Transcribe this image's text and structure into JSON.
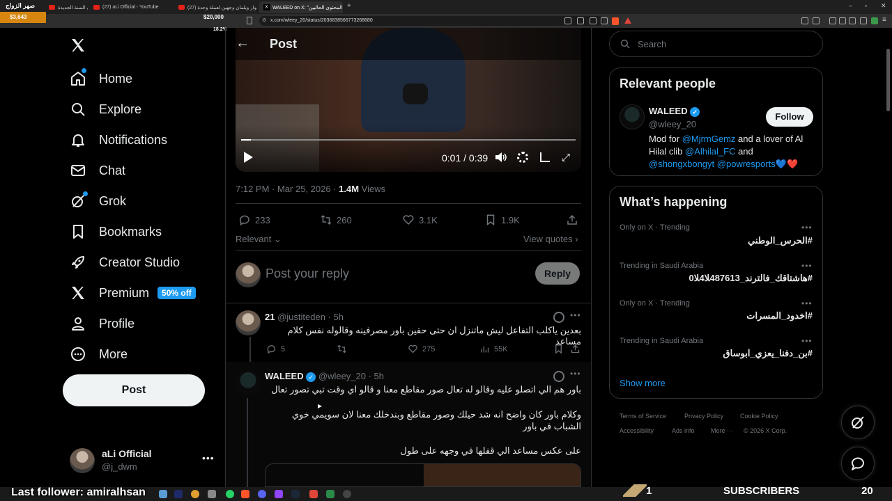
{
  "browser": {
    "tabs": [
      {
        "label": "اول بث في السنة الجديدة | aLi Official",
        "type": "youtube"
      },
      {
        "label": "(27) aLi Official - YouTube",
        "type": "youtube"
      },
      {
        "label": "(27) الحوار ويلمان وجهين لعملة وحدة",
        "type": "youtube"
      },
      {
        "label": "WALEED on X: \"المحتوى الحاليين",
        "type": "x"
      }
    ],
    "url": "x.com/wleey_20/status/2036838566773268680"
  },
  "overlay": {
    "channel_name": "صهر الزواج",
    "money_left": "$3,643",
    "money_right": "$20,000",
    "percent": "18.2%"
  },
  "nav": {
    "items": [
      {
        "label": "Home",
        "icon": "home-icon"
      },
      {
        "label": "Explore",
        "icon": "search-icon"
      },
      {
        "label": "Notifications",
        "icon": "bell-icon"
      },
      {
        "label": "Chat",
        "icon": "mail-icon"
      },
      {
        "label": "Grok",
        "icon": "grok-icon"
      },
      {
        "label": "Bookmarks",
        "icon": "bookmark-icon"
      },
      {
        "label": "Creator Studio",
        "icon": "rocket-icon"
      },
      {
        "label": "Premium",
        "icon": "x-logo-icon"
      },
      {
        "label": "Profile",
        "icon": "person-icon"
      },
      {
        "label": "More",
        "icon": "more-circle-icon"
      }
    ],
    "premium_badge": "50% off",
    "post_label": "Post"
  },
  "account": {
    "name": "aLi Official",
    "handle": "@j_dwm"
  },
  "header": {
    "title": "Post"
  },
  "video": {
    "time": "0:01 / 0:39"
  },
  "post": {
    "timestamp": "7:12 PM · Mar 25, 2026 · ",
    "views_count": "1.4M",
    "views_label": " Views",
    "replies": "233",
    "reposts": "260",
    "likes": "3.1K",
    "bookmarks": "1.9K",
    "sort_label": "Relevant",
    "view_quotes": "View quotes"
  },
  "composer": {
    "placeholder": "Post your reply",
    "reply_label": "Reply"
  },
  "replies": [
    {
      "name": "21",
      "handle": "@justiteden · 5h",
      "text": "بعدين ياكلب التفاعل ليش ماتنزل ان حتى حقين باور مصرفينه وقالوله نفس كلام مساعد",
      "replies": "5",
      "likes": "275",
      "views": "55K"
    },
    {
      "name": "WALEED",
      "handle": "@wleey_20 · 5h",
      "text1": "باور هم الي اتصلو عليه وقالو له تعال صور مقاطع معنا و قالو اي وقت تبي تصور تعال",
      "text2": "وكلام باور كان واضح انه شد حيلك وصور مقاطع وبندخلك معنا لان سويمي خوي الشباب في باور",
      "text3": "على عكس مساعد الي قفلها في وجهه على طول"
    }
  ],
  "search": {
    "placeholder": "Search"
  },
  "relevant": {
    "title": "Relevant people",
    "name": "WALEED",
    "handle": "@wleey_20",
    "follow": "Follow",
    "bio_1": "Mod for ",
    "bio_link1": "@MjrmGemz",
    "bio_2": " and a lover of Al Hilal clib ",
    "bio_link2": "@Alhilal_FC",
    "bio_3": " and ",
    "bio_link3": "@shongxbongyt",
    "bio_link4": " @powresports",
    "bio_emoji": "💙❤️"
  },
  "happening": {
    "title": "What’s happening",
    "trends": [
      {
        "meta": "Only on X · Trending",
        "name": "#الحرس_الوطني"
      },
      {
        "meta": "Trending in Saudi Arabia",
        "name": "#هاشتاقك_فالترند_487613ﻼ4ﻼ0"
      },
      {
        "meta": "Only on X · Trending",
        "name": "#اخدود_المسرات"
      },
      {
        "meta": "Trending in Saudi Arabia",
        "name": "#بن_دفنا_يعزي_ابوساق"
      }
    ],
    "show_more": "Show more"
  },
  "footer": {
    "links": [
      "Terms of Service",
      "Privacy Policy",
      "Cookie Policy",
      "Accessibility",
      "Ads info",
      "More ···",
      "© 2026 X Corp."
    ]
  },
  "stream": {
    "last_follower": "Last follower: amiralhsan",
    "level": "1",
    "subscribers_label": "SUBSCRIBERS",
    "subscribers_count": "20"
  },
  "colors": {
    "accent": "#1d9bf0",
    "background": "#000000",
    "border": "#2f3336",
    "muted": "#71767b"
  }
}
